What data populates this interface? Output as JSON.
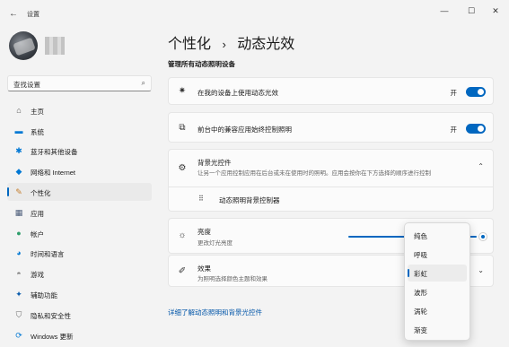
{
  "window": {
    "title": "设置",
    "back_glyph": "←",
    "controls": {
      "minimize": "—",
      "maximize": "☐",
      "close": "✕"
    }
  },
  "sidebar": {
    "search": {
      "placeholder": "查找设置",
      "icon": "search-icon",
      "glyph": "⌕"
    },
    "items": [
      {
        "label": "主页",
        "icon": "home-icon",
        "glyph": "⌂",
        "color": "#555555"
      },
      {
        "label": "系统",
        "icon": "system-monitor-icon",
        "glyph": "▬",
        "color": "#0078d4"
      },
      {
        "label": "蓝牙和其他设备",
        "icon": "bluetooth-icon",
        "glyph": "✱",
        "color": "#0078d4"
      },
      {
        "label": "网络和 Internet",
        "icon": "wifi-icon",
        "glyph": "◆",
        "color": "#0078d4"
      },
      {
        "label": "个性化",
        "icon": "pen-icon",
        "glyph": "✎",
        "color": "#c47d2c",
        "active": true
      },
      {
        "label": "应用",
        "icon": "apps-icon",
        "glyph": "▦",
        "color": "#4a5b78"
      },
      {
        "label": "帐户",
        "icon": "account-icon",
        "glyph": "●",
        "color": "#2e9e6b"
      },
      {
        "label": "时间和语言",
        "icon": "globe-clock-icon",
        "glyph": "◕",
        "color": "#0078d4"
      },
      {
        "label": "游戏",
        "icon": "gamepad-icon",
        "glyph": "◓",
        "color": "#7a7a7a"
      },
      {
        "label": "辅助功能",
        "icon": "accessibility-icon",
        "glyph": "✦",
        "color": "#0b5cad"
      },
      {
        "label": "隐私和安全性",
        "icon": "shield-icon",
        "glyph": "⛉",
        "color": "#6b6b6b"
      },
      {
        "label": "Windows 更新",
        "icon": "windows-update-icon",
        "glyph": "⟳",
        "color": "#0078d4"
      }
    ]
  },
  "main": {
    "breadcrumb_parent": "个性化",
    "breadcrumb_sep": "›",
    "breadcrumb_current": "动态光效",
    "section_header": "管理所有动态照明设备",
    "cards": {
      "use_on_devices": {
        "title": "在我的设备上使用动态光效",
        "toggle_text": "开",
        "toggle_on": true,
        "icon": "sparkle-icon",
        "glyph": "✷"
      },
      "compatible_apps": {
        "title": "前台中的兼容应用始终控制照明",
        "toggle_text": "开",
        "toggle_on": true,
        "icon": "apps-lighting-icon",
        "glyph": "⧉"
      },
      "background_light": {
        "title": "背景光控件",
        "subtitle": "让另一个应用控制应用在后台或未在使用时的照明。应用会按你在下方选择的顺序进行控制",
        "icon": "gear-icon",
        "glyph": "⚙",
        "chevron": "⌃",
        "sub_item": {
          "label": "动态照明背景控制器",
          "drag_glyph": "⠿"
        }
      },
      "brightness": {
        "title": "亮度",
        "subtitle": "更改灯光亮度",
        "icon": "brightness-icon",
        "glyph": "☼",
        "value_percent": 100
      },
      "effects": {
        "title": "效果",
        "subtitle": "为照明选择颜色主题和效果",
        "icon": "brush-icon",
        "glyph": "✐",
        "chevron": "⌄"
      }
    },
    "effects_dropdown": {
      "options": [
        "纯色",
        "呼吸",
        "彩虹",
        "波形",
        "涡轮",
        "渐变"
      ],
      "selected": "彩虹"
    },
    "footer_link": "详细了解动态照明和背景光控件"
  },
  "colors": {
    "accent": "#0067c0",
    "link": "#0055a8",
    "background": "#f3f3f3",
    "card": "#fbfbfb"
  }
}
